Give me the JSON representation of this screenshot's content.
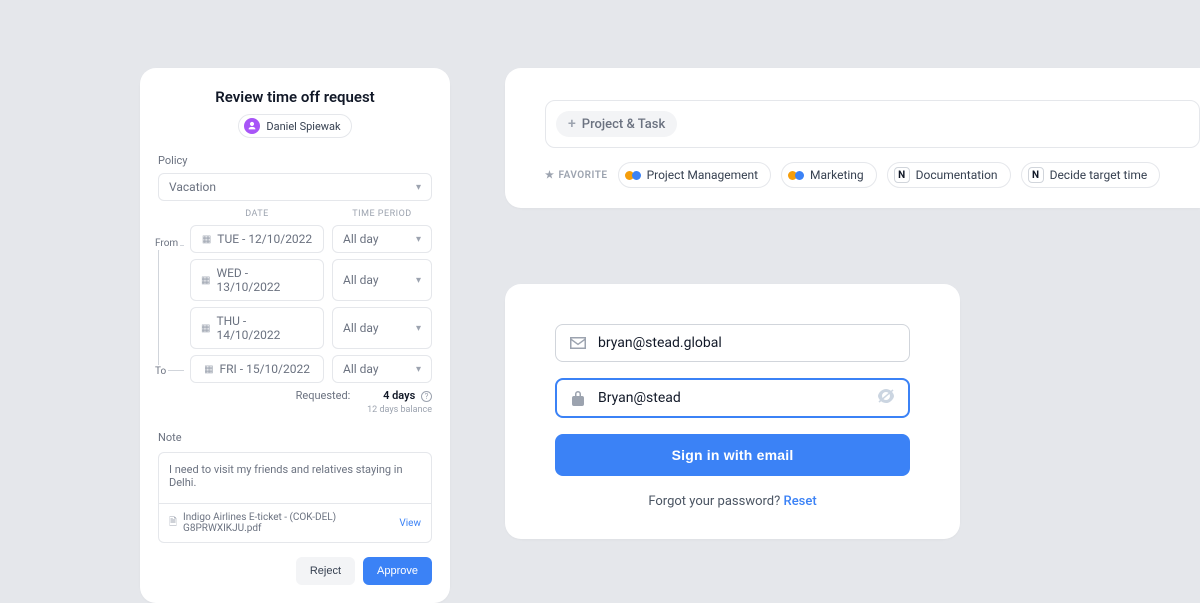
{
  "timeoff": {
    "title": "Review time off request",
    "user": "Daniel Spiewak",
    "policy_label": "Policy",
    "policy_value": "Vacation",
    "date_header": "DATE",
    "period_header": "TIME PERIOD",
    "from_label": "From",
    "to_label": "To",
    "rows": [
      {
        "date": "TUE - 12/10/2022",
        "period": "All day"
      },
      {
        "date": "WED - 13/10/2022",
        "period": "All day"
      },
      {
        "date": "THU - 14/10/2022",
        "period": "All day"
      },
      {
        "date": "FRI - 15/10/2022",
        "period": "All day"
      }
    ],
    "requested_label": "Requested:",
    "requested_value": "4 days",
    "balance": "12 days balance",
    "note_label": "Note",
    "note_text": "I need to visit my friends and relatives staying in Delhi.",
    "attachment": "Indigo Airlines E-ticket - (COK-DEL) G8PRWXIKJU.pdf",
    "view_label": "View",
    "reject_label": "Reject",
    "approve_label": "Approve"
  },
  "projectTask": {
    "chip": "Project & Task",
    "favorite_label": "FAVORITE",
    "favorites": [
      {
        "name": "Project Management",
        "icon": "monday"
      },
      {
        "name": "Marketing",
        "icon": "monday"
      },
      {
        "name": "Documentation",
        "icon": "notion"
      },
      {
        "name": "Decide target time",
        "icon": "notion"
      }
    ]
  },
  "login": {
    "email": "bryan@stead.global",
    "password": "Bryan@stead",
    "signin_label": "Sign in with email",
    "forgot_prefix": "Forgot your password? ",
    "reset_label": "Reset"
  }
}
